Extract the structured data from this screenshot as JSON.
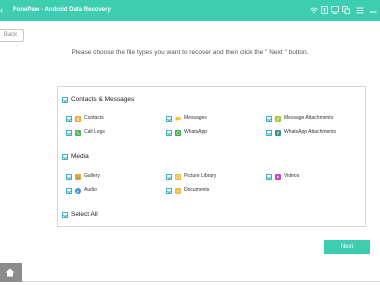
{
  "window": {
    "title": "FonePaw - Android Data Recovery",
    "accent_color": "#3ecdb0",
    "icons": [
      "wifi-icon",
      "register-icon",
      "cart-icon",
      "feedback-icon",
      "menu-icon",
      "minimize-icon"
    ]
  },
  "nav": {
    "back_label": "Back"
  },
  "instruction": "Please choose the file types you want to recover and then click the \" Next \" button.",
  "groups": {
    "contacts_messages": {
      "label": "Contacts & Messages",
      "items": [
        {
          "label": "Contacts",
          "icon": "contacts-icon",
          "color": "#f0a33a"
        },
        {
          "label": "Messages",
          "icon": "messages-icon",
          "color": "#f2c230"
        },
        {
          "label": "Message Attachments",
          "icon": "message-attachments-icon",
          "color": "#9dcb3c"
        },
        {
          "label": "Call Logs",
          "icon": "call-logs-icon",
          "color": "#4cb85a"
        },
        {
          "label": "WhatsApp",
          "icon": "whatsapp-icon",
          "color": "#3fa34d"
        },
        {
          "label": "WhatsApp Attachments",
          "icon": "whatsapp-attachments-icon",
          "color": "#3a8f8a"
        }
      ]
    },
    "media": {
      "label": "Media",
      "items": [
        {
          "label": "Gallery",
          "icon": "gallery-icon",
          "color": "#e8a63a"
        },
        {
          "label": "Picture Library",
          "icon": "picture-library-icon",
          "color": "#f2b640"
        },
        {
          "label": "Videos",
          "icon": "videos-icon",
          "color": "#c148c9"
        },
        {
          "label": "Audio",
          "icon": "audio-icon",
          "color": "#3f8fd6"
        },
        {
          "label": "Documents",
          "icon": "documents-icon",
          "color": "#f0b540"
        }
      ]
    },
    "select_all": {
      "label": "Select All"
    }
  },
  "actions": {
    "next_label": "Next"
  }
}
